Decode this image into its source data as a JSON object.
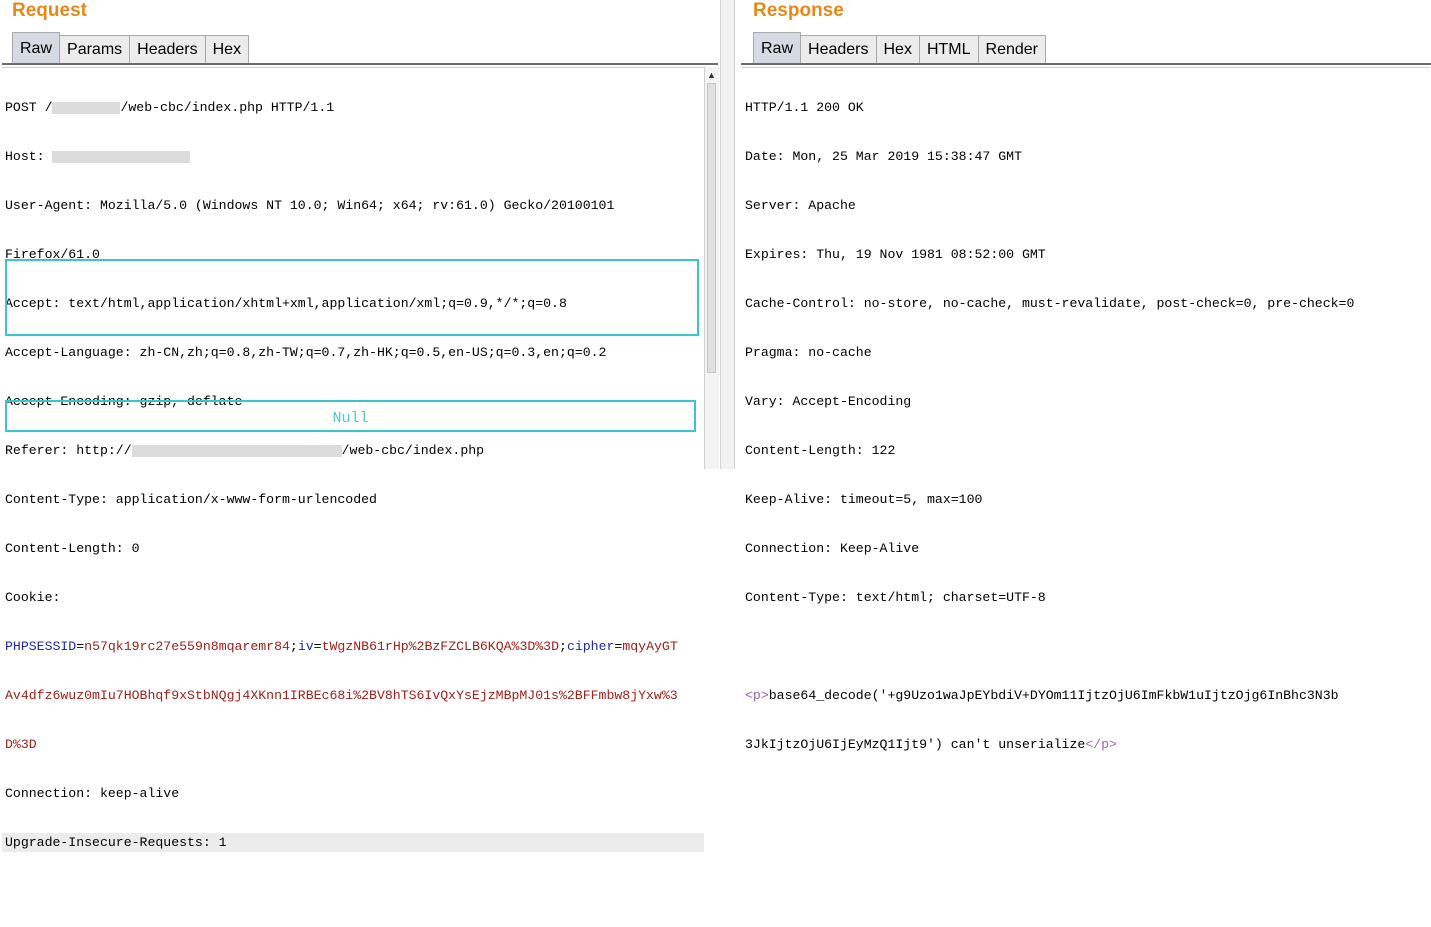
{
  "request": {
    "title": "Request",
    "tabs": [
      "Raw",
      "Params",
      "Headers",
      "Hex"
    ],
    "lines": {
      "post_prefix": "POST /",
      "post_suffix": "/web-cbc/index.php HTTP/1.1",
      "host": "Host: ",
      "user_agent_1": "User-Agent: Mozilla/5.0 (Windows NT 10.0; Win64; x64; rv:61.0) Gecko/20100101",
      "user_agent_2": "Firefox/61.0",
      "accept": "Accept: text/html,application/xhtml+xml,application/xml;q=0.9,*/*;q=0.8",
      "accept_language": "Accept-Language: zh-CN,zh;q=0.8,zh-TW;q=0.7,zh-HK;q=0.5,en-US;q=0.3,en;q=0.2",
      "accept_encoding": "Accept-Encoding: gzip, deflate",
      "referer_prefix": "Referer: http://",
      "referer_suffix": "/web-cbc/index.php",
      "content_type": "Content-Type: application/x-www-form-urlencoded",
      "content_length": "Content-Length: 0",
      "cookie": "Cookie:",
      "connection": "Connection: keep-alive",
      "upgrade": "Upgrade-Insecure-Requests: 1"
    },
    "cookie": {
      "phpsessid_key": "PHPSESSID",
      "phpsessid_val": "n57qk19rc27e559n8mqaremr84",
      "iv_key": "iv",
      "iv_val": "tWgzNB61rHp%2BzFZCLB6KQA%3D%3D",
      "cipher_key": "cipher",
      "cipher_val_1": "mqyAyGT",
      "cipher_val_2": "Av4dfz6wuz0mIu7HOBhqf9xStbNQgj4XKnn1IRBEc68i%2BV8hTS6IvQxYsEjzMBpMJ01s%2BFFmbw8jYxw%3",
      "cipher_val_3": "D%3D"
    },
    "null_label": "Null"
  },
  "response": {
    "title": "Response",
    "tabs": [
      "Raw",
      "Headers",
      "Hex",
      "HTML",
      "Render"
    ],
    "lines": [
      "HTTP/1.1 200 OK",
      "Date: Mon, 25 Mar 2019 15:38:47 GMT",
      "Server: Apache",
      "Expires: Thu, 19 Nov 1981 08:52:00 GMT",
      "Cache-Control: no-store, no-cache, must-revalidate, post-check=0, pre-check=0",
      "Pragma: no-cache",
      "Vary: Accept-Encoding",
      "Content-Length: 122",
      "Keep-Alive: timeout=5, max=100",
      "Connection: Keep-Alive",
      "Content-Type: text/html; charset=UTF-8"
    ],
    "body": {
      "open_tag": "<p>",
      "text_1": "base64_decode('+g9Uzo1waJpEYbdiV+DYOm11IjtzOjU6ImFkbW1uIjtzOjg6InBhc3N3b",
      "text_2": "3JkIjtzOjU6IjEyMzQ1Ijt9') can't unserialize",
      "close_tag": "</p>"
    }
  }
}
